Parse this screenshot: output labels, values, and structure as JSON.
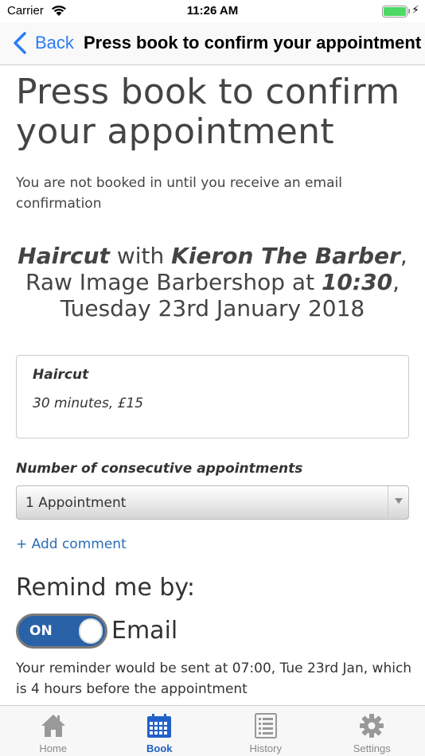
{
  "status_bar": {
    "carrier": "Carrier",
    "time": "11:26 AM",
    "battery_level": 1.0
  },
  "nav": {
    "back_label": "Back",
    "title": "Press book to confirm your appointment"
  },
  "main": {
    "title": "Press book to confirm your appointment",
    "subtitle": "You are not booked in until you receive an email confirmation",
    "summary": {
      "service": "Haircut",
      "with_text": " with ",
      "barber": "Kieron The Barber",
      "comma1": ",",
      "shop": "Raw Image Barbershop at ",
      "time": "10:30",
      "comma2": ",",
      "date": "Tuesday 23rd January 2018"
    },
    "service_card": {
      "name": "Haircut",
      "detail": "30 minutes, £15"
    },
    "consecutive_label": "Number of consecutive appointments",
    "consecutive_selected": "1 Appointment",
    "add_comment": "+ Add comment",
    "remind_title": "Remind me by:",
    "toggle": {
      "state": "ON",
      "label": "Email"
    },
    "reminder_note": "Your reminder would be sent at 07:00, Tue 23rd Jan, which is 4 hours before the appointment"
  },
  "tab_bar": {
    "tabs": [
      {
        "label": "Home",
        "icon": "home-icon",
        "active": false
      },
      {
        "label": "Book",
        "icon": "calendar-icon",
        "active": true
      },
      {
        "label": "History",
        "icon": "list-icon",
        "active": false
      },
      {
        "label": "Settings",
        "icon": "gear-icon",
        "active": false
      }
    ]
  },
  "colors": {
    "accent": "#2060c8",
    "link": "#2a6db5",
    "toggle_on": "#2a62a8",
    "battery": "#4cd964"
  }
}
